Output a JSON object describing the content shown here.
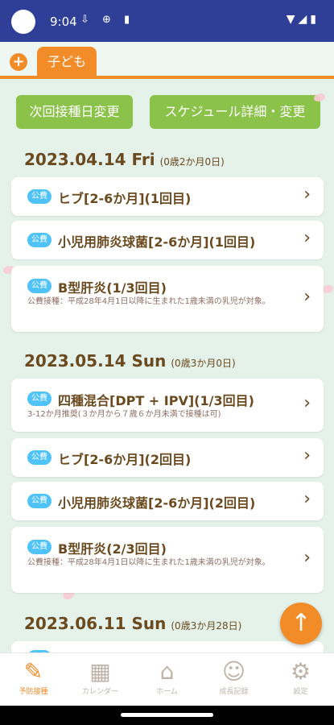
{
  "status": {
    "time": "9:04",
    "icons": "⇩ ⊕ ▮",
    "right": "▼◢▮"
  },
  "tab": {
    "add_icon": "+",
    "child": "子ども"
  },
  "buttons": {
    "next_change": "次回接種日変更",
    "schedule": "スケジュール詳細・変更"
  },
  "badge": "公費",
  "groups": [
    {
      "date": "2023.04.14 Fri",
      "age": "(0歳2か月0日)",
      "items": [
        {
          "title": "ヒブ[2-6か月](1回目)",
          "sub": ""
        },
        {
          "title": "小児用肺炎球菌[2-6か月](1回目)",
          "sub": ""
        },
        {
          "title": "B型肝炎(1/3回目)",
          "sub": "公費接種：平成28年4月1日以降に生まれた1歳未満の乳児が対象。"
        }
      ]
    },
    {
      "date": "2023.05.14 Sun",
      "age": "(0歳3か月0日)",
      "items": [
        {
          "title": "四種混合[DPT + IPV](1/3回目)",
          "sub": "3-12か月推奨(３か月から７歳６か月未満で接種は可)"
        },
        {
          "title": "ヒブ[2-6か月](2回目)",
          "sub": ""
        },
        {
          "title": "小児用肺炎球菌[2-6か月](2回目)",
          "sub": ""
        },
        {
          "title": "B型肝炎(2/3回目)",
          "sub": "公費接種：平成28年4月1日以降に生まれた1歳未満の乳児が対象。"
        }
      ]
    },
    {
      "date": "2023.06.11 Sun",
      "age": "(0歳3か月28日)",
      "items": []
    }
  ],
  "fab_icon": "↑",
  "nav": [
    {
      "label": "予防接種",
      "icon": "syringe-icon",
      "glyph": "✎"
    },
    {
      "label": "カレンダー",
      "icon": "calendar-icon",
      "glyph": "▦"
    },
    {
      "label": "ホーム",
      "icon": "home-icon",
      "glyph": "⌂"
    },
    {
      "label": "成長記録",
      "icon": "face-icon",
      "glyph": "☺"
    },
    {
      "label": "設定",
      "icon": "gear-icon",
      "glyph": "⚙"
    }
  ],
  "colors": {
    "accent": "#f28c28",
    "green": "#8bc34a",
    "badge": "#4fc3f7",
    "text": "#6b4a1f",
    "statusbar": "#2f3f98"
  }
}
